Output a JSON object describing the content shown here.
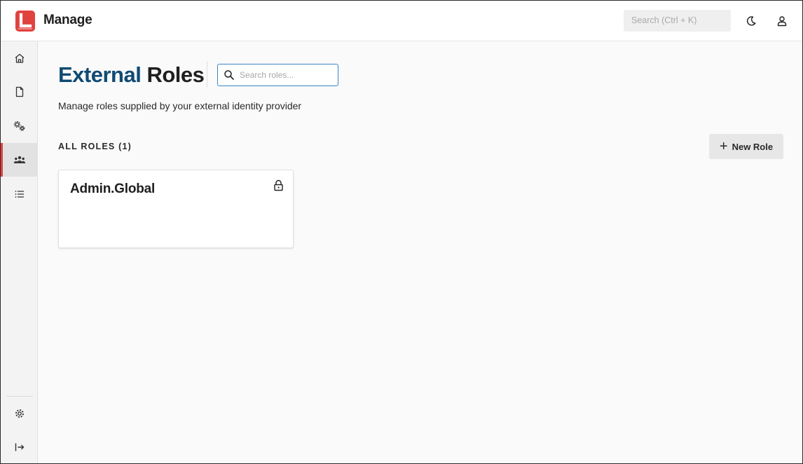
{
  "app": {
    "title": "Manage",
    "brand_color": "#e0433f",
    "accent_color": "#0f4a73"
  },
  "topbar": {
    "search_placeholder": "Search (Ctrl + K)",
    "icons": [
      "moon-icon",
      "user-icon"
    ]
  },
  "sidebar": {
    "items": [
      {
        "icon": "home-icon",
        "active": false
      },
      {
        "icon": "document-icon",
        "active": false
      },
      {
        "icon": "gears-icon",
        "active": false
      },
      {
        "icon": "users-icon",
        "active": true
      },
      {
        "icon": "list-icon",
        "active": false
      }
    ],
    "bottom_items": [
      {
        "icon": "settings-icon"
      },
      {
        "icon": "collapse-icon"
      }
    ]
  },
  "page": {
    "title_accent": "External",
    "title_rest": "Roles",
    "search_placeholder": "Search roles...",
    "subtitle": "Manage roles supplied by your external identity provider",
    "section_label": "ALL ROLES (1)",
    "new_role_label": "New Role"
  },
  "roles": [
    {
      "name": "Admin.Global",
      "locked": true
    }
  ]
}
